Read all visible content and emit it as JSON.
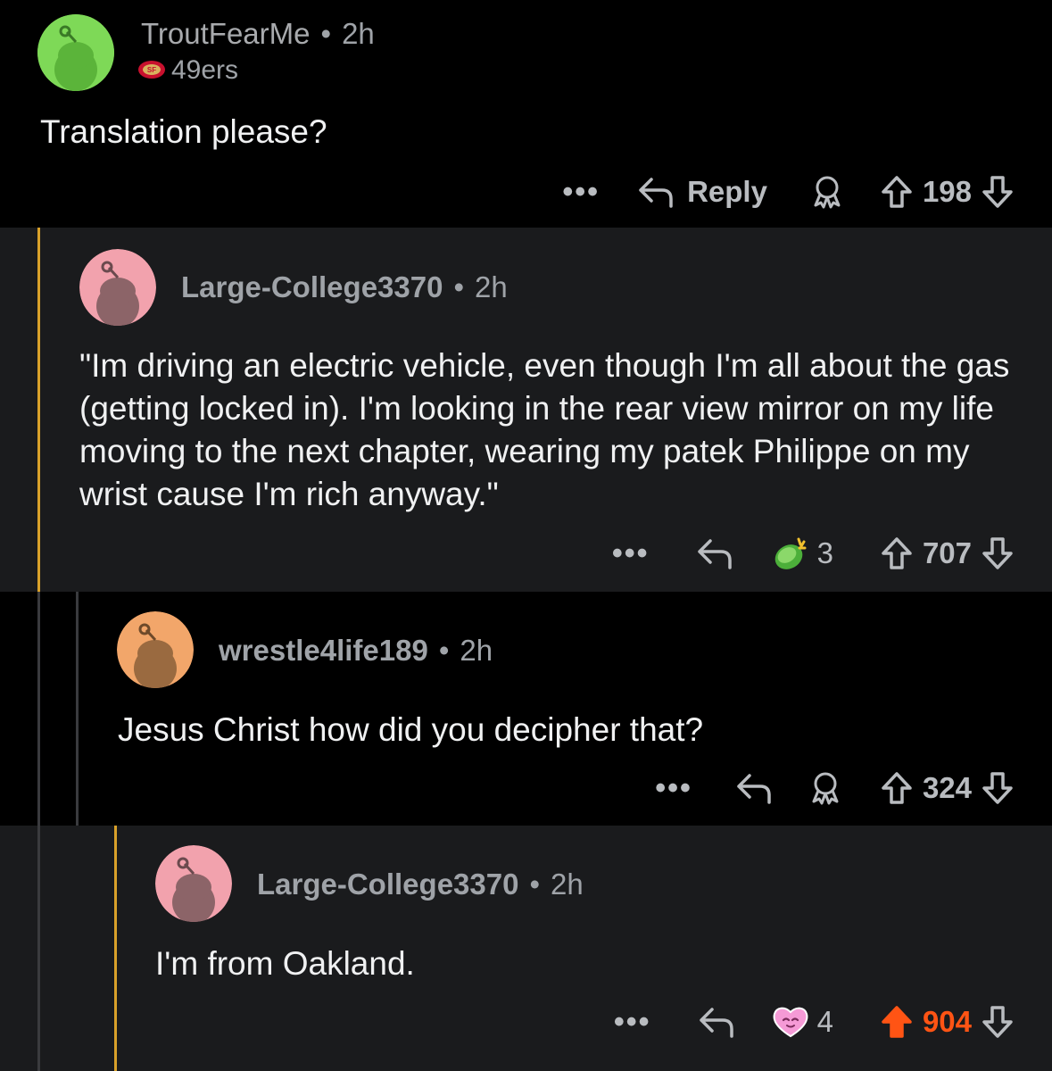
{
  "comments": [
    {
      "username": "TroutFearMe",
      "time": "2h",
      "flair": "49ers",
      "body": "Translation please?",
      "reply_label": "Reply",
      "score": "198",
      "avatar_color": "#7ed957"
    },
    {
      "username": "Large-College3370",
      "time": "2h",
      "body": "\"Im driving an electric vehicle, even though I'm all about the gas (getting locked in). I'm looking in the rear view mirror on my life moving to the next chapter, wearing my patek Philippe on my wrist cause I'm rich anyway.\"",
      "award_count": "3",
      "score": "707",
      "avatar_color": "#f2a2ad"
    },
    {
      "username": "wrestle4life189",
      "time": "2h",
      "body": "Jesus Christ how did you decipher that?",
      "score": "324",
      "avatar_color": "#f2a66a"
    },
    {
      "username": "Large-College3370",
      "time": "2h",
      "body": "I'm from Oakland.",
      "award_count": "4",
      "score": "904",
      "avatar_color": "#f2a2ad"
    }
  ],
  "colors": {
    "thread_orange": "#d9a12a",
    "upvoted": "#ff5414"
  },
  "icons": [
    "more-icon",
    "reply-icon",
    "award-icon",
    "upvote-icon",
    "downvote-icon",
    "49ers-flair-icon"
  ]
}
